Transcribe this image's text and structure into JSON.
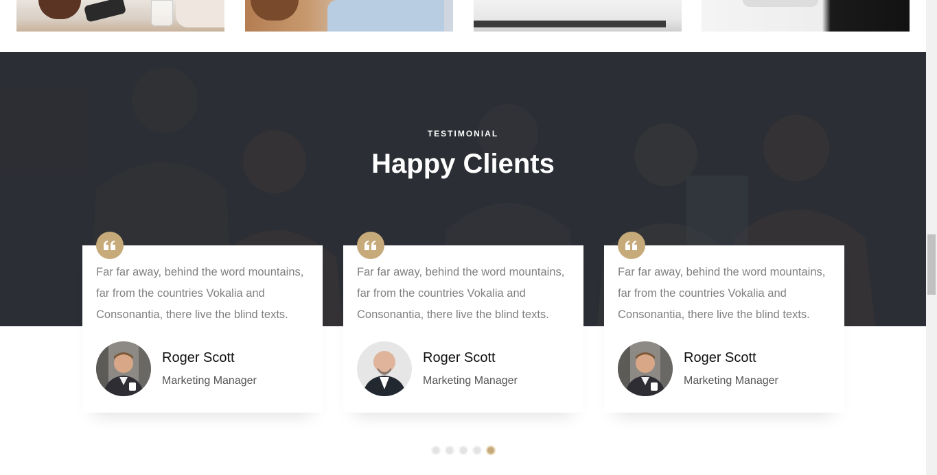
{
  "testimonial": {
    "eyebrow": "TESTIMONIAL",
    "title": "Happy Clients",
    "accent_color": "#c6aa7a",
    "cards": [
      {
        "quote": "Far far away, behind the word mountains, far from the countries Vokalia and Consonantia, there live the blind texts.",
        "name": "Roger Scott",
        "role": "Marketing Manager"
      },
      {
        "quote": "Far far away, behind the word mountains, far from the countries Vokalia and Consonantia, there live the blind texts.",
        "name": "Roger Scott",
        "role": "Marketing Manager"
      },
      {
        "quote": "Far far away, behind the word mountains, far from the countries Vokalia and Consonantia, there live the blind texts.",
        "name": "Roger Scott",
        "role": "Marketing Manager"
      }
    ]
  },
  "carousel": {
    "dot_count": 5,
    "active_index": 5
  },
  "icons": {
    "quote": "quote-icon"
  }
}
